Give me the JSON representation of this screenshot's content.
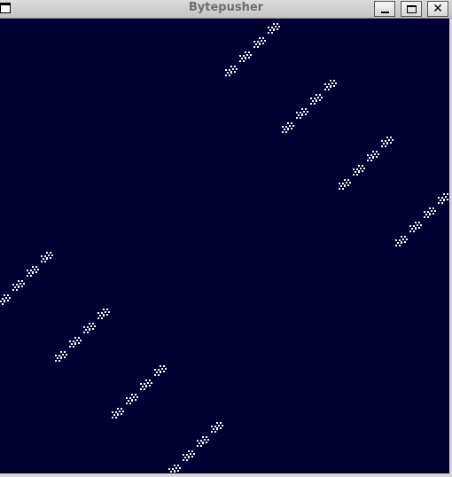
{
  "window": {
    "title": "Bytepusher"
  },
  "screen": {
    "background": "#000033",
    "dot_color": "#ffffff"
  },
  "colors": {
    "titlebar": "#c8c8c8",
    "title_text": "#6e6e6e",
    "frame": "#d5d5d5"
  },
  "icons": {
    "menu": "window-menu-icon",
    "minimize": "minimize-icon",
    "maximize": "maximize-icon",
    "close": "close-icon"
  }
}
